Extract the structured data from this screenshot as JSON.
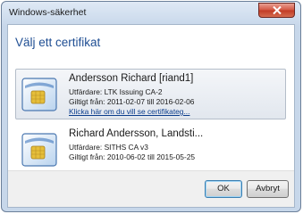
{
  "window": {
    "title": "Windows-säkerhet",
    "close_icon": "close-x-icon"
  },
  "dialog": {
    "heading": "Välj ett certifikat",
    "certificates": [
      {
        "name": "Andersson Richard [riand1]",
        "issuer": "Utfärdare: LTK Issuing CA-2",
        "validity": "Giltigt från: 2011-02-07 till 2016-02-06",
        "link": "Klicka här om du vill se certifikateg...",
        "icon": "certificate-card-icon",
        "selected": true
      },
      {
        "name": "Richard Andersson, Landsti...",
        "issuer": "Utfärdare: SITHS CA v3",
        "validity": "Giltigt från: 2010-06-02 till 2015-05-25",
        "icon": "certificate-card-icon",
        "selected": false
      }
    ]
  },
  "buttons": {
    "ok": "OK",
    "cancel": "Avbryt"
  },
  "colors": {
    "heading": "#1f4e93",
    "link": "#0b3d8c",
    "close_button": "#c13a24",
    "selection": "#e2e7ee"
  }
}
